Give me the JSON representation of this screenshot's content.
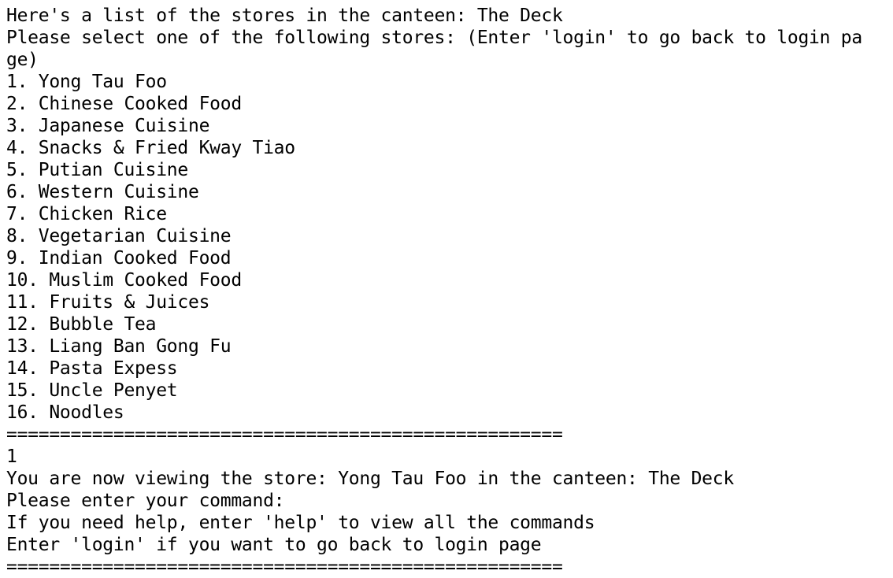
{
  "terminal": {
    "header_line": "Here's a list of the stores in the canteen: The Deck",
    "prompt_line_1": "Please select one of the following stores: (Enter 'login' to go back to login pa",
    "prompt_line_2": "ge)",
    "stores": [
      "1. Yong Tau Foo",
      "2. Chinese Cooked Food",
      "3. Japanese Cuisine",
      "4. Snacks & Fried Kway Tiao",
      "5. Putian Cuisine",
      "6. Western Cuisine",
      "7. Chicken Rice",
      "8. Vegetarian Cuisine",
      "9. Indian Cooked Food",
      "10. Muslim Cooked Food",
      "11. Fruits & Juices",
      "12. Bubble Tea",
      "13. Liang Ban Gong Fu",
      "14. Pasta Expess",
      "15. Uncle Penyet",
      "16. Noodles"
    ],
    "separator": "====================================================",
    "user_input": "1",
    "viewing_line": "You are now viewing the store: Yong Tau Foo in the canteen: The Deck",
    "command_prompt": "Please enter your command:",
    "help_hint": "If you need help, enter 'help' to view all the commands",
    "login_hint": "Enter 'login' if you want to go back to login page",
    "separator_end": "===================================================="
  }
}
